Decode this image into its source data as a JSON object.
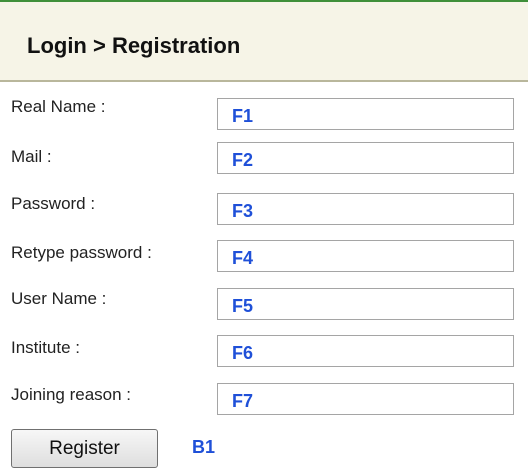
{
  "header": {
    "title": "Login > Registration"
  },
  "form": {
    "fields": [
      {
        "label": "Real Name :",
        "value": "F1"
      },
      {
        "label": "Mail :",
        "value": "F2"
      },
      {
        "label": "Password :",
        "value": "F3"
      },
      {
        "label": "Retype password :",
        "value": "F4"
      },
      {
        "label": "User Name :",
        "value": "F5"
      },
      {
        "label": "Institute :",
        "value": "F6"
      },
      {
        "label": "Joining reason :",
        "value": "F7"
      }
    ],
    "register_label": "Register",
    "register_tag": "B1"
  },
  "colors": {
    "tag_text": "#1f50d8",
    "header_background": "#f6f4e7",
    "header_border": "#3f8f3a"
  }
}
